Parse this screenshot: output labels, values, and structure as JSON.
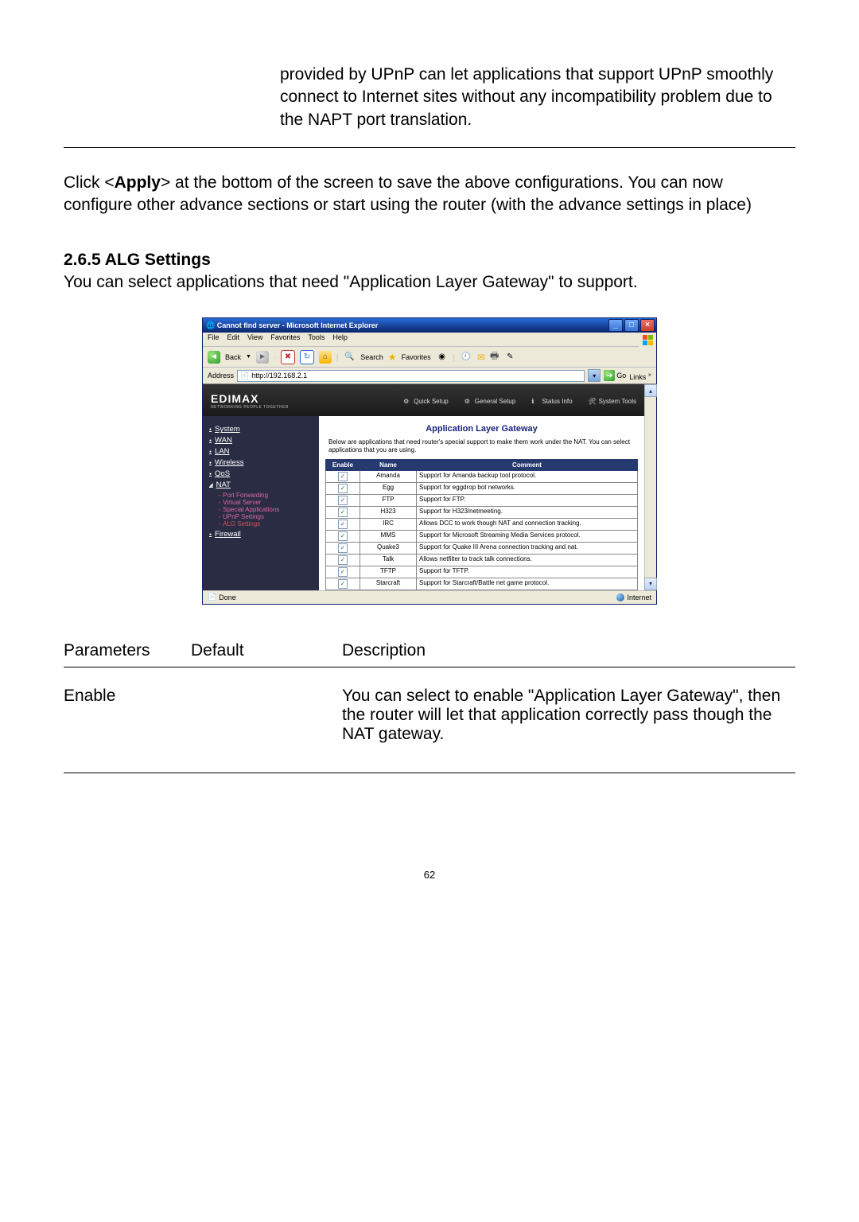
{
  "intro_fragment": "provided by UPnP can let applications that support UPnP smoothly connect to Internet sites without any incompatibility problem due to the NAPT port translation.",
  "click_apply": "Click <Apply> at the bottom of the screen to save the above configurations. You can now configure other advance sections or start using the router (with the advance settings in place)",
  "section": {
    "num_title": "2.6.5 ALG Settings",
    "body": "You can select applications that need \"Application Layer Gateway\" to support."
  },
  "ie": {
    "title": "Cannot find server - Microsoft Internet Explorer",
    "menus": [
      "File",
      "Edit",
      "View",
      "Favorites",
      "Tools",
      "Help"
    ],
    "toolbar": {
      "back": "Back",
      "search": "Search",
      "favorites": "Favorites"
    },
    "address_label": "Address",
    "address_value": "http://192.168.2.1",
    "go": "Go",
    "links": "Links",
    "status_done": "Done",
    "status_zone": "Internet"
  },
  "router": {
    "brand": "EDIMAX",
    "brand_sub": "NETWORKING PEOPLE TOGETHER",
    "topnav": [
      "Quick Setup",
      "General Setup",
      "Status Info",
      "System Tools"
    ],
    "sidebar": {
      "items": [
        "System",
        "WAN",
        "LAN",
        "Wireless",
        "QoS",
        "NAT",
        "Firewall"
      ],
      "nat_sub": [
        "Port Forwarding",
        "Virtual Server",
        "Special Applications",
        "UPnP Settings",
        "ALG Settings"
      ]
    },
    "page_title": "Application Layer Gateway",
    "page_desc": "Below are applications that need router's special support to make them work under the NAT. You can select applications that you are using.",
    "table": {
      "headers": [
        "Enable",
        "Name",
        "Comment"
      ],
      "rows": [
        {
          "name": "Amanda",
          "comment": "Support for Amanda backup tool protocol."
        },
        {
          "name": "Egg",
          "comment": "Support for eggdrop bot networks."
        },
        {
          "name": "FTP",
          "comment": "Support for FTP."
        },
        {
          "name": "H323",
          "comment": "Support for H323/netmeeting."
        },
        {
          "name": "IRC",
          "comment": "Allows DCC to work though NAT and connection tracking."
        },
        {
          "name": "MMS",
          "comment": "Support for Microsoft Streaming Media Services protocol."
        },
        {
          "name": "Quake3",
          "comment": "Support for Quake III Arena connection tracking and nat."
        },
        {
          "name": "Talk",
          "comment": "Allows netfilter to track talk connections."
        },
        {
          "name": "TFTP",
          "comment": "Support for TFTP."
        },
        {
          "name": "Starcraft",
          "comment": "Support for Starcraft/Battle net game protocol."
        }
      ]
    }
  },
  "param_table": {
    "head": [
      "Parameters",
      "Default",
      "Description"
    ],
    "row": {
      "param": "Enable",
      "default": "",
      "desc": "You can select to enable \"Application Layer Gateway\", then the router will let that application correctly pass though the NAT gateway."
    }
  },
  "page_number": "62"
}
